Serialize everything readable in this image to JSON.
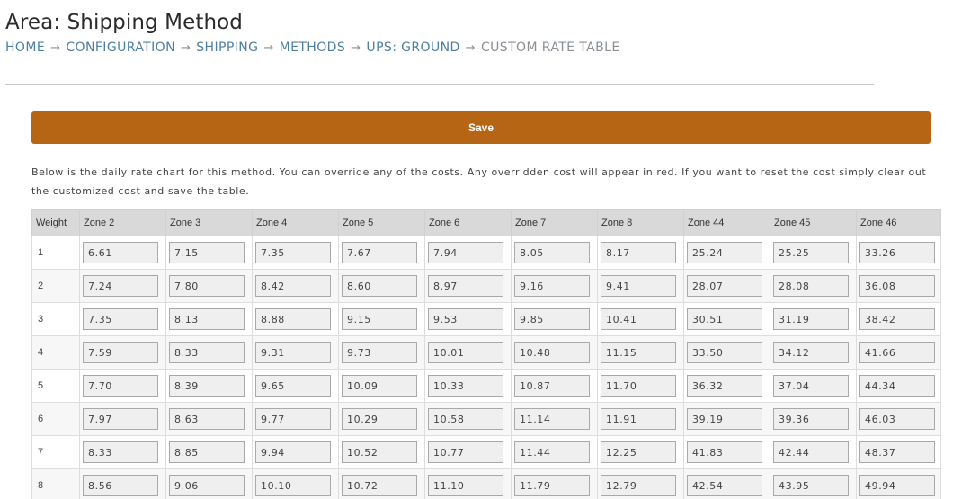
{
  "page": {
    "title": "Area: Shipping Method",
    "breadcrumb": [
      {
        "label": "HOME",
        "link": true
      },
      {
        "label": "CONFIGURATION",
        "link": true
      },
      {
        "label": "SHIPPING",
        "link": true
      },
      {
        "label": "METHODS",
        "link": true
      },
      {
        "label": "UPS: GROUND",
        "link": true
      },
      {
        "label": "CUSTOM RATE TABLE",
        "link": false
      }
    ],
    "separator": "→"
  },
  "toolbar": {
    "save_label": "Save"
  },
  "description": "Below is the daily rate chart for this method. You can override any of the costs. Any overridden cost will appear in red. If you want to reset the cost simply clear out the customized cost and save the table.",
  "colors": {
    "accent": "#b56514",
    "link": "#4e7ea0",
    "header_bg": "#d9d9d9"
  },
  "table": {
    "headers": [
      "Weight",
      "Zone 2",
      "Zone 3",
      "Zone 4",
      "Zone 5",
      "Zone 6",
      "Zone 7",
      "Zone 8",
      "Zone 44",
      "Zone 45",
      "Zone 46"
    ],
    "rows": [
      {
        "weight": "1",
        "values": [
          "6.61",
          "7.15",
          "7.35",
          "7.67",
          "7.94",
          "8.05",
          "8.17",
          "25.24",
          "25.25",
          "33.26"
        ]
      },
      {
        "weight": "2",
        "values": [
          "7.24",
          "7.80",
          "8.42",
          "8.60",
          "8.97",
          "9.16",
          "9.41",
          "28.07",
          "28.08",
          "36.08"
        ]
      },
      {
        "weight": "3",
        "values": [
          "7.35",
          "8.13",
          "8.88",
          "9.15",
          "9.53",
          "9.85",
          "10.41",
          "30.51",
          "31.19",
          "38.42"
        ]
      },
      {
        "weight": "4",
        "values": [
          "7.59",
          "8.33",
          "9.31",
          "9.73",
          "10.01",
          "10.48",
          "11.15",
          "33.50",
          "34.12",
          "41.66"
        ]
      },
      {
        "weight": "5",
        "values": [
          "7.70",
          "8.39",
          "9.65",
          "10.09",
          "10.33",
          "10.87",
          "11.70",
          "36.32",
          "37.04",
          "44.34"
        ]
      },
      {
        "weight": "6",
        "values": [
          "7.97",
          "8.63",
          "9.77",
          "10.29",
          "10.58",
          "11.14",
          "11.91",
          "39.19",
          "39.36",
          "46.03"
        ]
      },
      {
        "weight": "7",
        "values": [
          "8.33",
          "8.85",
          "9.94",
          "10.52",
          "10.77",
          "11.44",
          "12.25",
          "41.83",
          "42.44",
          "48.37"
        ]
      },
      {
        "weight": "8",
        "values": [
          "8.56",
          "9.06",
          "10.10",
          "10.72",
          "11.10",
          "11.79",
          "12.79",
          "42.54",
          "43.95",
          "49.94"
        ]
      }
    ]
  }
}
